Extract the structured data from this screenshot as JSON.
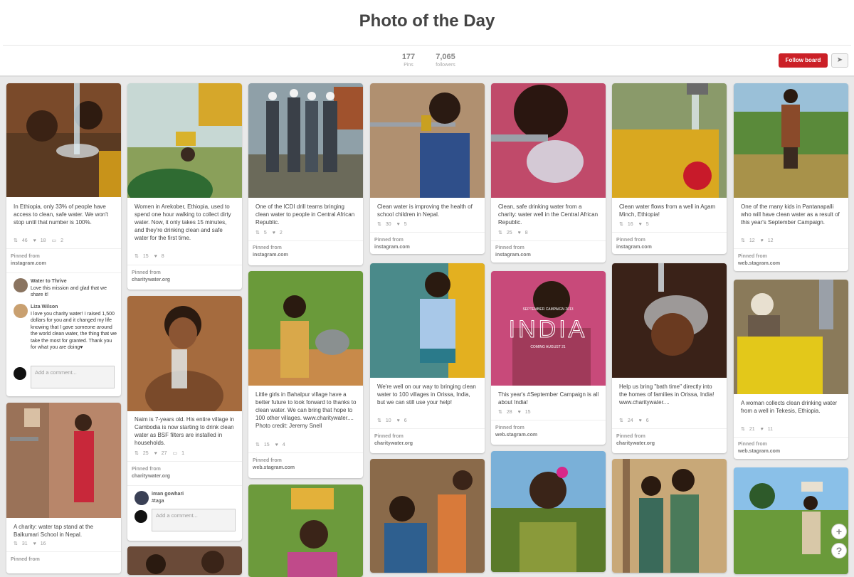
{
  "board": {
    "title": "Photo of the Day"
  },
  "stats": {
    "pins_count": "177",
    "pins_label": "Pins",
    "followers_count": "7,065",
    "followers_label": "followers"
  },
  "actions": {
    "follow_label": "Follow board",
    "send_icon": "send-icon"
  },
  "pinned_from_label": "Pinned from",
  "add_comment_placeholder": "Add a comment...",
  "pins": [
    {
      "desc": "In Ethiopia, only 33% of people have access to clean, safe water. We won't stop until that number is 100%.",
      "repins": "46",
      "likes": "18",
      "comments": "2",
      "source": "instagram.com"
    },
    {
      "desc": "Women in Arekober, Ethiopia, used to spend one hour walking to collect dirty water. Now, it only takes 15 minutes, and they're drinking clean and safe water for the first time.",
      "repins": "15",
      "likes": "8",
      "source": "charitywater.org"
    },
    {
      "desc": "One of the ICDI drill teams bringing clean water to people in Central African Republic.",
      "repins": "5",
      "likes": "2",
      "source": "instagram.com"
    },
    {
      "desc": "Clean water is improving the health of school children in Nepal.",
      "repins": "30",
      "likes": "5",
      "source": "instagram.com"
    },
    {
      "desc": "Clean, safe drinking water from a charity: water well in the Central African Republic.",
      "repins": "25",
      "likes": "8",
      "source": "instagram.com"
    },
    {
      "desc": "Clean water flows from a well in Agam Minch, Ethiopia!",
      "repins": "16",
      "likes": "5",
      "source": "instagram.com"
    },
    {
      "desc": "One of the many kids in Pantanapalli who will have clean water as a result of this year's September Campaign.",
      "repins": "12",
      "likes": "12",
      "source": "web.stagram.com"
    },
    {
      "desc": "A charity: water tap stand at the Balkumari School in Nepal.",
      "repins": "31",
      "likes": "16",
      "source": ""
    },
    {
      "desc": "Naim is 7-years old. His entire village in Cambodia is now starting to drink clean water as BSF filters are installed in households.",
      "repins": "25",
      "likes": "27",
      "comments": "1",
      "source": "charitywater.org"
    },
    {
      "desc": "Little girls in Bahalpur village have a better future to look forward to thanks to clean water. We can bring that hope to 100 other villages. www.charitywater.... Photo credit: Jeremy Snell",
      "repins": "15",
      "likes": "4",
      "source": "web.stagram.com"
    },
    {
      "desc": "We're well on our way to bringing clean water to 100 villages in Orissa, India, but we can still use your help!",
      "repins": "10",
      "likes": "6",
      "source": "charitywater.org"
    },
    {
      "desc": "This year's #September Campaign is all about India!",
      "repins": "28",
      "likes": "15",
      "source": "web.stagram.com"
    },
    {
      "desc": "Help us bring \"bath time\" directly into the homes of families in Orissa, India! www.charitywater....",
      "repins": "24",
      "likes": "6",
      "source": "charitywater.org"
    },
    {
      "desc": "A woman collects clean drinking water from a well in Tekesis, Ethiopia.",
      "repins": "21",
      "likes": "11",
      "source": "web.stagram.com"
    }
  ],
  "comments": [
    {
      "name": "Water to Thrive",
      "text": "Love this mission and glad that we share it!"
    },
    {
      "name": "Liza Wilson",
      "text": "I love you charity water! I raised 1,500 dollars for you and it changed my life knowing that I gave someone around the world clean water, the thing that we take the most for granted. Thank you for what you are doing♥"
    },
    {
      "name": "iman gowhari",
      "text": "#taga"
    }
  ],
  "campaign_overlay": {
    "top": "SEPTEMBER CAMPAIGN 2013",
    "main": "INDIA",
    "bottom": "COMING AUGUST 21"
  },
  "float_buttons": {
    "add": "+",
    "help": "?"
  },
  "colors": {
    "accent": "#cb2027"
  }
}
